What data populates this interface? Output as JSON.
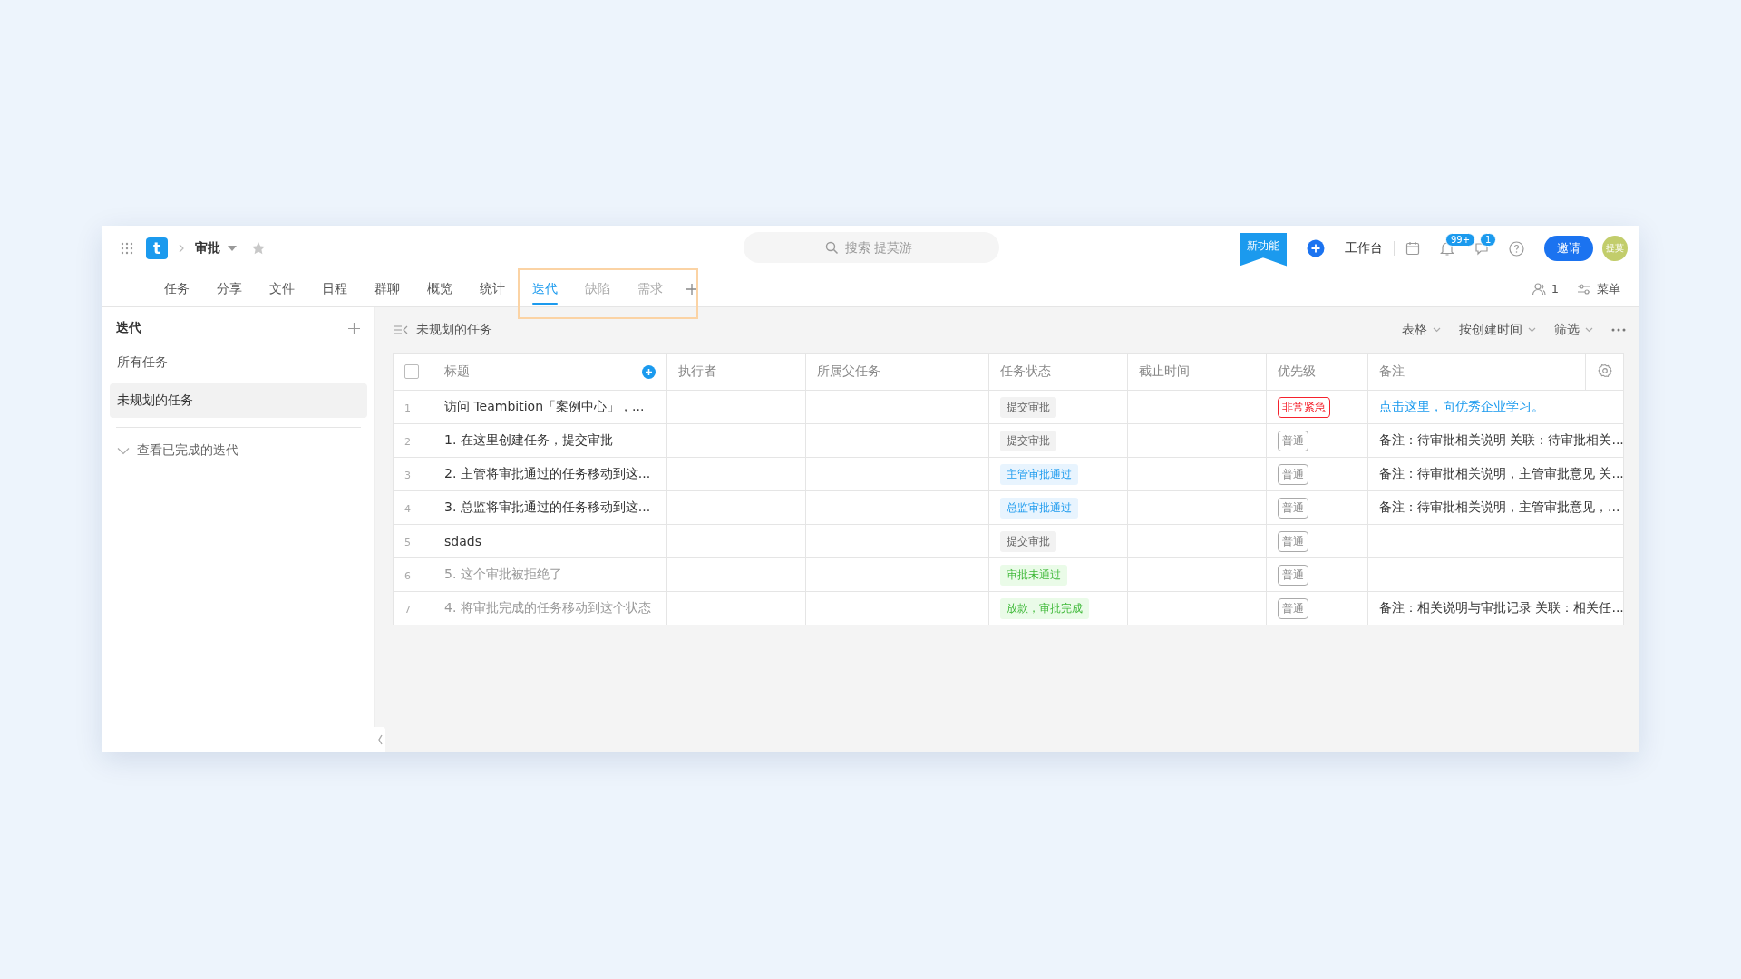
{
  "header": {
    "logo": "t",
    "project": "审批",
    "search": {
      "placeholder": "搜索 提莫游"
    },
    "new_feature": "新功能",
    "workbench": "工作台",
    "notifications_badge": "99+",
    "messages_badge": "1",
    "invite": "邀请",
    "avatar": "提莫"
  },
  "tabs": [
    {
      "label": "任务",
      "selected": false,
      "disabled": false
    },
    {
      "label": "分享",
      "selected": false,
      "disabled": false
    },
    {
      "label": "文件",
      "selected": false,
      "disabled": false
    },
    {
      "label": "日程",
      "selected": false,
      "disabled": false
    },
    {
      "label": "群聊",
      "selected": false,
      "disabled": false
    },
    {
      "label": "概览",
      "selected": false,
      "disabled": false
    },
    {
      "label": "统计",
      "selected": false,
      "disabled": false
    },
    {
      "label": "迭代",
      "selected": true,
      "disabled": false
    },
    {
      "label": "缺陷",
      "selected": false,
      "disabled": true
    },
    {
      "label": "需求",
      "selected": false,
      "disabled": true
    }
  ],
  "tab_bar_right": {
    "members": "1",
    "menu": "菜单"
  },
  "sidebar": {
    "title": "迭代",
    "items": [
      {
        "label": "所有任务",
        "selected": false
      },
      {
        "label": "未规划的任务",
        "selected": true
      }
    ],
    "completed": {
      "label": "查看已完成的迭代",
      "expanded": false
    }
  },
  "toolbar": {
    "title": "未规划的任务",
    "options": [
      "表格",
      "按创建时间",
      "筛选"
    ]
  },
  "table": {
    "select_all": {
      "checked": false
    },
    "columns": [
      "标题",
      "执行者",
      "所属父任务",
      "任务状态",
      "截止时间",
      "优先级",
      "备注"
    ],
    "rows": [
      {
        "index": "1",
        "title": "访问 Teambition「案例中心」，...",
        "done": false,
        "status": {
          "label": "提交审批",
          "kind": "neutral"
        },
        "priority": {
          "label": "非常紧急",
          "kind": "urgent"
        },
        "note": {
          "text": "点击这里，向优秀企业学习。",
          "kind": "link"
        }
      },
      {
        "index": "2",
        "title": "1. 在这里创建任务，提交审批",
        "done": false,
        "status": {
          "label": "提交审批",
          "kind": "neutral"
        },
        "priority": {
          "label": "普通",
          "kind": "normal"
        },
        "note": {
          "text": "备注：待审批相关说明 关联：待审批相关...",
          "kind": "text"
        }
      },
      {
        "index": "3",
        "title": "2. 主管将审批通过的任务移动到这...",
        "done": false,
        "status": {
          "label": "主管审批通过",
          "kind": "info"
        },
        "priority": {
          "label": "普通",
          "kind": "normal"
        },
        "note": {
          "text": "备注：待审批相关说明，主管审批意见 关...",
          "kind": "text"
        }
      },
      {
        "index": "4",
        "title": "3. 总监将审批通过的任务移动到这...",
        "done": false,
        "status": {
          "label": "总监审批通过",
          "kind": "info"
        },
        "priority": {
          "label": "普通",
          "kind": "normal"
        },
        "note": {
          "text": "备注：待审批相关说明，主管审批意见，...",
          "kind": "text"
        }
      },
      {
        "index": "5",
        "title": "sdads",
        "done": false,
        "status": {
          "label": "提交审批",
          "kind": "neutral"
        },
        "priority": {
          "label": "普通",
          "kind": "normal"
        }
      },
      {
        "index": "6",
        "title": "5. 这个审批被拒绝了",
        "done": true,
        "status": {
          "label": "审批未通过",
          "kind": "success"
        },
        "priority": {
          "label": "普通",
          "kind": "normal"
        }
      },
      {
        "index": "7",
        "title": "4. 将审批完成的任务移动到这个状态",
        "done": true,
        "status": {
          "label": "放款，审批完成",
          "kind": "success"
        },
        "priority": {
          "label": "普通",
          "kind": "normal"
        },
        "note": {
          "text": "备注：相关说明与审批记录 关联：相关任...",
          "kind": "text"
        }
      }
    ]
  }
}
